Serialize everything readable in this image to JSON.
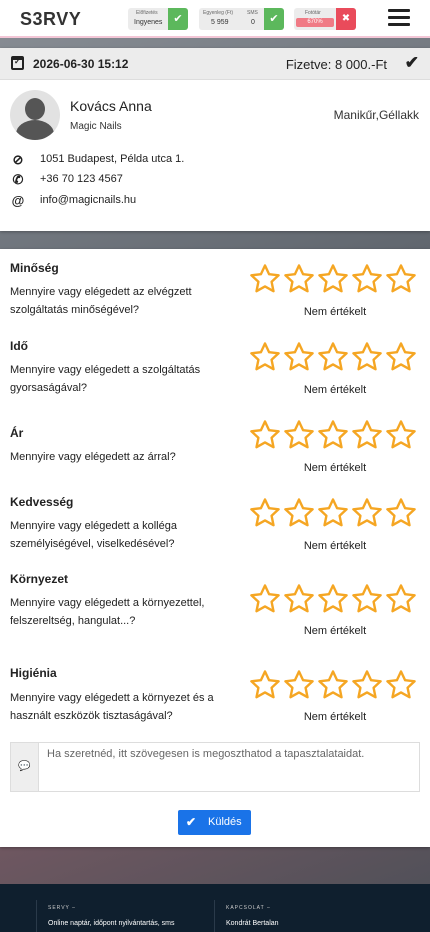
{
  "header": {
    "logo": "S3RVY",
    "widgets": {
      "prepayment": {
        "caption": "Előfizetés",
        "value": "Ingyenes"
      },
      "balance": {
        "caption": "Egyenleg (Ft)",
        "value": "5 959",
        "sms_caption": "SMS",
        "sms_value": "0"
      },
      "usage": {
        "caption": "Fotótár",
        "value": "670%"
      }
    }
  },
  "booking": {
    "datetime": "2026-06-30 15:12",
    "paid": "Fizetve: 8 000.-Ft",
    "name": "Kovács Anna",
    "company": "Magic Nails",
    "services": "Manikűr,Géllakk",
    "address": "1051 Budapest, Példa utca 1.",
    "phone": "+36 70 123 4567",
    "email": "info@magicnails.hu"
  },
  "ratings": {
    "not_rated_label": "Nem értékelt",
    "criteria": [
      {
        "title": "Minőség",
        "question": "Mennyire vagy elégedett az elvégzett szolgáltatás minőségével?",
        "value": 0
      },
      {
        "title": "Idő",
        "question": "Mennyire vagy elégedett a szolgáltatás gyorsaságával?",
        "value": 0
      },
      {
        "title": "Ár",
        "question": "Mennyire vagy elégedett az árral?",
        "value": 0
      },
      {
        "title": "Kedvesség",
        "question": "Mennyire vagy elégedett a kolléga személyiségével, viselkedésével?",
        "value": 0
      },
      {
        "title": "Környezet",
        "question": "Mennyire vagy elégedett a környezettel, felszereltség, hangulat...?",
        "value": 0
      },
      {
        "title": "Higiénia",
        "question": "Mennyire vagy elégedett a környezet és a használt eszközök tisztaságával?",
        "value": 0
      }
    ],
    "max_stars": 5,
    "star_color": "#f5a623"
  },
  "comment": {
    "placeholder": "Ha szeretnéd, itt szövegesen is megoszthatod a tapasztalataidat.",
    "value": ""
  },
  "send_label": "Küldés",
  "footer": {
    "col1_head": "SERVY –",
    "col1_text": "Online naptár, időpont nyilvántartás, sms",
    "col2_head": "KAPCSOLAT –",
    "col2_text": "Kondrát Bertalan"
  }
}
